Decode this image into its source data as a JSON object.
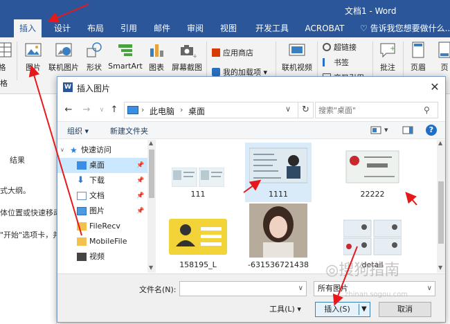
{
  "window": {
    "title": "文档1 - Word"
  },
  "tabs": [
    {
      "label": "插入",
      "active": true
    },
    {
      "label": "设计"
    },
    {
      "label": "布局"
    },
    {
      "label": "引用"
    },
    {
      "label": "邮件"
    },
    {
      "label": "审阅"
    },
    {
      "label": "视图"
    },
    {
      "label": "开发工具"
    },
    {
      "label": "ACROBAT"
    }
  ],
  "tell_me": "告诉我您想要做什么...",
  "ribbon": {
    "left_partial_top": "格",
    "left_partial_bottom": "格",
    "picture": "图片",
    "online_picture": "联机图片",
    "shapes": "形状",
    "smartart": "SmartArt",
    "chart": "图表",
    "screenshot": "屏幕截图",
    "app_store": "应用商店",
    "my_addins": "我的加载项",
    "online_video": "联机视频",
    "hyperlink": "超链接",
    "bookmark": "书签",
    "cross_ref": "交叉引用",
    "comment": "批注",
    "header": "页眉",
    "footer_partial": "页"
  },
  "doc": {
    "nav_result": "结果",
    "line1": "式大纲。",
    "line2": "体位置或快速移动",
    "line3": "\"开始\"选项卡，并"
  },
  "dialog": {
    "title": "插入图片",
    "close": "✕",
    "breadcrumb": [
      "此电脑",
      "桌面"
    ],
    "search_placeholder": "搜索\"桌面\"",
    "organize": "组织 ▾",
    "new_folder": "新建文件夹",
    "nav_items": [
      {
        "label": "快速访问",
        "icon": "star-icon",
        "color": "#2f7ed8"
      },
      {
        "label": "桌面",
        "icon": "desktop-icon",
        "color": "#3a8ee6",
        "selected": true
      },
      {
        "label": "下载",
        "icon": "download-icon",
        "color": "#2f7ed8"
      },
      {
        "label": "文档",
        "icon": "document-icon",
        "color": "#6b8db5"
      },
      {
        "label": "图片",
        "icon": "picture-icon",
        "color": "#4c9be0"
      },
      {
        "label": "FileRecv",
        "icon": "folder-icon",
        "color": "#f2c14e"
      },
      {
        "label": "MobileFile",
        "icon": "folder-icon",
        "color": "#f2c14e"
      },
      {
        "label": "视频",
        "icon": "video-icon",
        "color": "#444"
      }
    ],
    "files": [
      {
        "name": "111"
      },
      {
        "name": "1111",
        "selected": true
      },
      {
        "name": "22222"
      },
      {
        "name": "158195_L"
      },
      {
        "name": "-631536721438"
      },
      {
        "name": "detail"
      }
    ],
    "filename_label": "文件名(N):",
    "filename_value": "",
    "filter": "所有图片",
    "tools": "工具(L)  ▾",
    "insert": "插入(S)",
    "cancel": "取消"
  },
  "watermark": {
    "main": "搜狗指南",
    "sub": "zhinan.sogou.com"
  },
  "colors": {
    "ribbon_blue": "#2b579a",
    "annotation_red": "#e8171a"
  }
}
